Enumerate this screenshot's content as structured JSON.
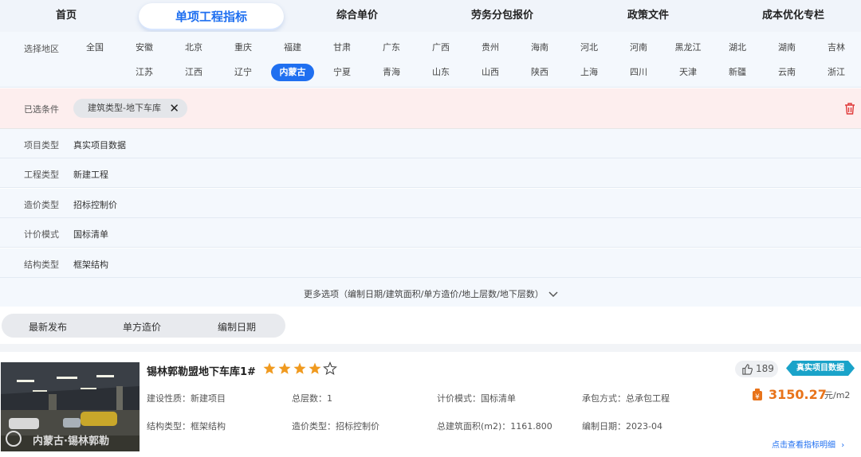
{
  "nav": {
    "tabs": [
      {
        "label": "首页"
      },
      {
        "label": "单项工程指标"
      },
      {
        "label": "综合单价"
      },
      {
        "label": "劳务分包报价"
      },
      {
        "label": "政策文件"
      },
      {
        "label": "成本优化专栏"
      }
    ],
    "active_index": 1
  },
  "region": {
    "label": "选择地区",
    "items": [
      "全国",
      "安徽",
      "北京",
      "重庆",
      "福建",
      "甘肃",
      "广东",
      "广西",
      "贵州",
      "海南",
      "河北",
      "河南",
      "黑龙江",
      "湖北",
      "湖南",
      "吉林",
      "江苏",
      "江西",
      "辽宁",
      "内蒙古",
      "宁夏",
      "青海",
      "山东",
      "山西",
      "陕西",
      "上海",
      "四川",
      "天津",
      "新疆",
      "云南",
      "浙江"
    ],
    "selected": "内蒙古"
  },
  "selected_conditions": {
    "label": "已选条件",
    "chips": [
      "建筑类型-地下车库"
    ]
  },
  "filters": [
    {
      "label": "项目类型",
      "value": "真实项目数据"
    },
    {
      "label": "工程类型",
      "value": "新建工程"
    },
    {
      "label": "造价类型",
      "value": "招标控制价"
    },
    {
      "label": "计价模式",
      "value": "国标清单"
    },
    {
      "label": "结构类型",
      "value": "框架结构"
    }
  ],
  "more_options": "更多选项（编制日期/建筑面积/单方造价/地上层数/地下层数）",
  "sort": [
    "最新发布",
    "单方造价",
    "编制日期"
  ],
  "project": {
    "title": "锡林郭勒盟地下车库1#",
    "rating": 4,
    "rating_max": 5,
    "likes": "189",
    "tag": "真实项目数据",
    "price": "3150.27",
    "unit": "元/m2",
    "detail_link": "点击查看指标明细",
    "thumb_caption": "内蒙古·锡林郭勒",
    "meta": {
      "nature": "建设性质：新建项目",
      "floors": "总层数：1",
      "mode": "计价模式：国标清单",
      "contract": "承包方式：总承包工程",
      "structure": "结构类型：框架结构",
      "cost_type": "造价类型：招标控制价",
      "area": "总建筑面积(m2)：1161.800",
      "date": "编制日期：2023-04"
    }
  },
  "colors": {
    "accent": "#1f6ff0",
    "price": "#e8731a",
    "star": "#f09a1f",
    "tag": "#1aa3c9",
    "selected_bar": "#fdeeee",
    "trash": "#e03a3a"
  }
}
